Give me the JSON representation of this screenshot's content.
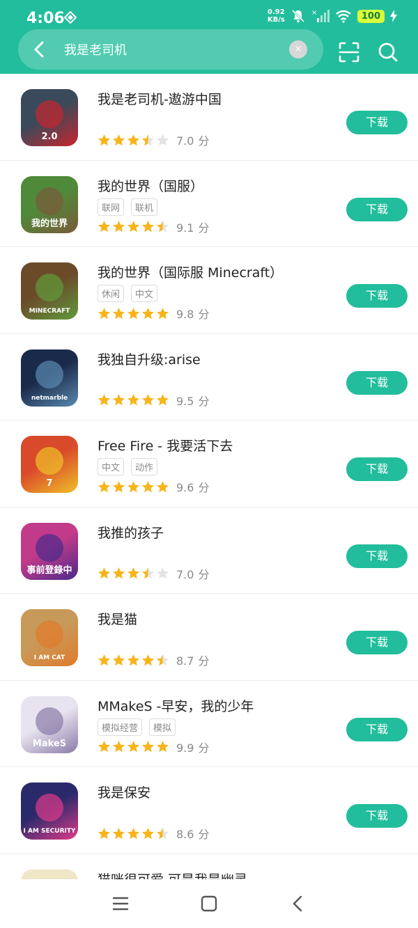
{
  "status": {
    "time": "4:06",
    "net_speed_value": "0.92",
    "net_speed_unit": "KB/s",
    "battery": "100"
  },
  "search": {
    "query": "我是老司机",
    "clear_icon": "×"
  },
  "download_label": "下载",
  "score_unit": "分",
  "apps": [
    {
      "name": "我是老司机-遨游中国",
      "tags": [],
      "stars": [
        2,
        2,
        2,
        1,
        0
      ],
      "score": "7.0",
      "icon": {
        "bg": "#3a4a5a",
        "fg": "#c8252d",
        "text": "2.0"
      }
    },
    {
      "name": "我的世界（国服）",
      "tags": [
        "联网",
        "联机"
      ],
      "stars": [
        2,
        2,
        2,
        2,
        1
      ],
      "score": "9.1",
      "icon": {
        "bg": "#4f8a3a",
        "fg": "#7a5a3a",
        "text": "我的世界"
      }
    },
    {
      "name": "我的世界（国际服 Minecraft）",
      "tags": [
        "休闲",
        "中文"
      ],
      "stars": [
        2,
        2,
        2,
        2,
        2
      ],
      "score": "9.8",
      "icon": {
        "bg": "#6b4a2a",
        "fg": "#5f9b3b",
        "text": "MINECRAFT"
      }
    },
    {
      "name": "我独自升级:arise",
      "tags": [],
      "stars": [
        2,
        2,
        2,
        2,
        2
      ],
      "score": "9.5",
      "icon": {
        "bg": "#1a2a4a",
        "fg": "#5a8ab0",
        "text": "netmarble"
      }
    },
    {
      "name": "Free Fire - 我要活下去",
      "tags": [
        "中文",
        "动作"
      ],
      "stars": [
        2,
        2,
        2,
        2,
        2
      ],
      "score": "9.6",
      "icon": {
        "bg": "#d94a2a",
        "fg": "#f0c02a",
        "text": "7"
      }
    },
    {
      "name": "我推的孩子",
      "tags": [],
      "stars": [
        2,
        2,
        2,
        1,
        0
      ],
      "score": "7.0",
      "icon": {
        "bg": "#c23a8a",
        "fg": "#4a2a8a",
        "text": "事前登錄中"
      }
    },
    {
      "name": "我是猫",
      "tags": [],
      "stars": [
        2,
        2,
        2,
        2,
        1
      ],
      "score": "8.7",
      "icon": {
        "bg": "#c89a5a",
        "fg": "#e07a2a",
        "text": "I AM CAT"
      }
    },
    {
      "name": "MMakeS -早安，我的少年",
      "tags": [
        "模拟经营",
        "模拟"
      ],
      "stars": [
        2,
        2,
        2,
        2,
        2
      ],
      "score": "9.9",
      "icon": {
        "bg": "#e8e4ef",
        "fg": "#8a7aa8",
        "text": "MakeS"
      }
    },
    {
      "name": "我是保安",
      "tags": [],
      "stars": [
        2,
        2,
        2,
        2,
        1
      ],
      "score": "8.6",
      "icon": {
        "bg": "#2a2a6a",
        "fg": "#e03a8a",
        "text": "I AM SECURITY"
      }
    },
    {
      "name": "猫咪很可爱 可是我是幽灵",
      "tags": [],
      "stars": [],
      "score": "",
      "icon": {
        "bg": "#f0e6c8",
        "fg": "#d8c08a",
        "text": ""
      }
    }
  ],
  "colors": {
    "accent": "#22bd9c",
    "star": "#f7b51b",
    "star_empty": "#e3e3e3"
  }
}
